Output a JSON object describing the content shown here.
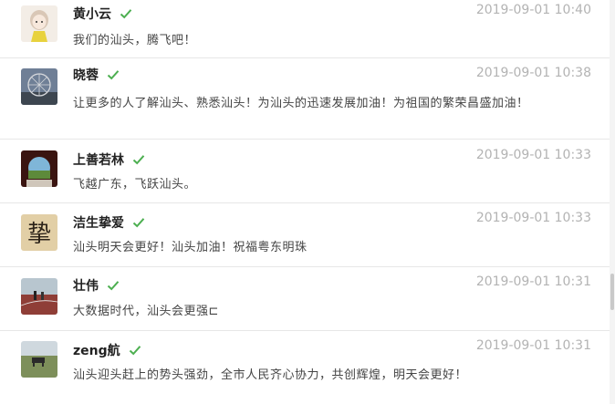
{
  "colors": {
    "check": "#4caf50",
    "divider": "#e7e7e7",
    "time": "#b3b3b3"
  },
  "comments": [
    {
      "name": "黄小云",
      "time": "2019-09-01 10:40",
      "text": "我们的汕头，腾飞吧！",
      "avatar": "cartoon-girl-avatar",
      "verified_icon": "check-icon"
    },
    {
      "name": "晓蓉",
      "time": "2019-09-01 10:38",
      "text": "让更多的人了解汕头、熟悉汕头！为汕头的迅速发展加油！为祖国的繁荣昌盛加油！",
      "avatar": "ferris-wheel-avatar",
      "verified_icon": "check-icon"
    },
    {
      "name": "上善若林",
      "time": "2019-09-01 10:33",
      "text": "飞越广东，飞跃汕头。",
      "avatar": "round-window-avatar",
      "verified_icon": "check-icon"
    },
    {
      "name": "洁生挚爱",
      "time": "2019-09-01 10:33",
      "text": "汕头明天会更好！汕头加油！祝福粤东明珠",
      "avatar": "calligraphy-avatar",
      "avatar_text": "挚",
      "verified_icon": "check-icon"
    },
    {
      "name": "壮伟",
      "time": "2019-09-01 10:31",
      "text": "大数据时代，汕头会更强⊏",
      "avatar": "running-track-avatar",
      "verified_icon": "check-icon"
    },
    {
      "name": "zeng航",
      "time": "2019-09-01 10:31",
      "text": "汕头迎头赶上的势头强劲，全市人民齐心协力，共创辉煌，明天会更好！",
      "avatar": "grassland-avatar",
      "verified_icon": "check-icon"
    }
  ]
}
